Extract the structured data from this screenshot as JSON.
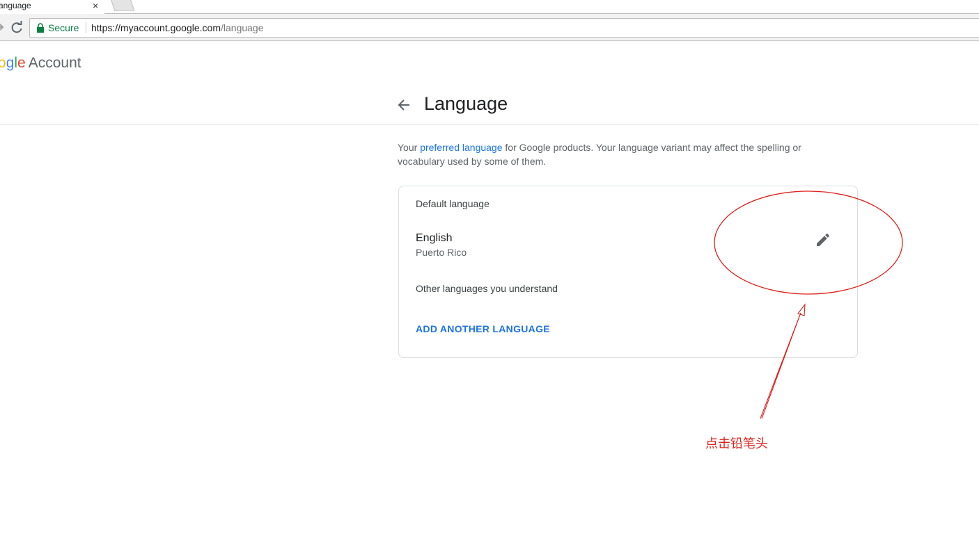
{
  "browser": {
    "tab_title": "anguage",
    "tab_close": "×",
    "security_label": "Secure",
    "url_host": "https://myaccount.google.com",
    "url_path": "/language"
  },
  "header": {
    "logo_letters": [
      "o",
      "g",
      "l",
      "e"
    ],
    "logo_suffix": "Account"
  },
  "page": {
    "title": "Language",
    "intro_before": "Your ",
    "intro_link": "preferred language",
    "intro_after": " for Google products. Your language variant may affect the spelling or vocabulary used by some of them."
  },
  "card": {
    "default_label": "Default language",
    "language_name": "English",
    "language_region": "Puerto Rico",
    "other_label": "Other languages you understand",
    "add_button": "ADD ANOTHER LANGUAGE"
  },
  "annotation": {
    "text": "点击铅笔头",
    "color": "#e0201b"
  },
  "colors": {
    "link_blue": "#1a73e8",
    "secure_green": "#0b8043"
  }
}
